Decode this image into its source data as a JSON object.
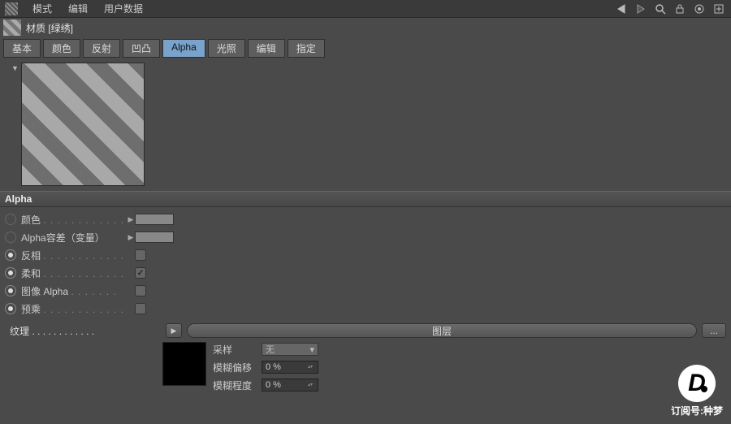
{
  "menubar": {
    "items": [
      "模式",
      "编辑",
      "用户数据"
    ]
  },
  "title": "材质 [绿绣]",
  "tabs": [
    "基本",
    "颜色",
    "反射",
    "凹凸",
    "Alpha",
    "光照",
    "编辑",
    "指定"
  ],
  "active_tab": "Alpha",
  "section_header": "Alpha",
  "params": {
    "color_label": "颜色",
    "tolerance_label": "Alpha容差（变量）",
    "invert_label": "反相",
    "soft_label": "柔和",
    "image_alpha_label": "图像 Alpha",
    "premult_label": "预乘",
    "texture_label": "纹理",
    "layer_bar": "图层",
    "more": "...",
    "sampling_label": "采样",
    "sampling_value": "无",
    "blur_offset_label": "模糊偏移",
    "blur_offset_value": "0 %",
    "blur_scale_label": "模糊程度",
    "blur_scale_value": "0 %"
  },
  "checks": {
    "invert": false,
    "soft": true,
    "image_alpha": false,
    "premult": false
  },
  "watermark": {
    "logo": "D",
    "text": "订阅号:种梦"
  }
}
